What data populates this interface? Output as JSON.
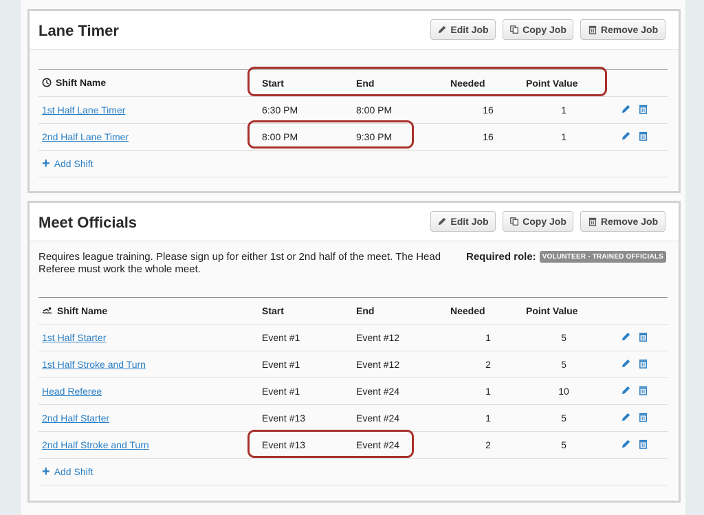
{
  "jobs": [
    {
      "title": "Lane Timer",
      "buttons": {
        "edit": "Edit Job",
        "copy": "Copy Job",
        "remove": "Remove Job"
      },
      "shift_icon": "clock-icon",
      "headers": {
        "name": "Shift Name",
        "start": "Start",
        "end": "End",
        "needed": "Needed",
        "points": "Point Value"
      },
      "shifts": [
        {
          "name": "1st Half Lane Timer",
          "start": "6:30 PM",
          "end": "8:00 PM",
          "needed": "16",
          "points": "1"
        },
        {
          "name": "2nd Half Lane Timer",
          "start": "8:00 PM",
          "end": "9:30 PM",
          "needed": "16",
          "points": "1"
        }
      ],
      "add_shift": "Add Shift"
    },
    {
      "title": "Meet Officials",
      "buttons": {
        "edit": "Edit Job",
        "copy": "Copy Job",
        "remove": "Remove Job"
      },
      "description": "Requires league training. Please sign up for either 1st or 2nd half of the meet. The Head Referee must work the whole meet.",
      "required_role_label": "Required role:",
      "required_role": "VOLUNTEER - TRAINED OFFICIALS",
      "shift_icon": "swimmer-icon",
      "headers": {
        "name": "Shift Name",
        "start": "Start",
        "end": "End",
        "needed": "Needed",
        "points": "Point Value"
      },
      "shifts": [
        {
          "name": "1st Half Starter",
          "start": "Event #1",
          "end": "Event #12",
          "needed": "1",
          "points": "5"
        },
        {
          "name": "1st Half Stroke and Turn",
          "start": "Event #1",
          "end": "Event #12",
          "needed": "2",
          "points": "5"
        },
        {
          "name": "Head Referee",
          "start": "Event #1",
          "end": "Event #24",
          "needed": "1",
          "points": "10"
        },
        {
          "name": "2nd Half Starter",
          "start": "Event #13",
          "end": "Event #24",
          "needed": "1",
          "points": "5"
        },
        {
          "name": "2nd Half Stroke and Turn",
          "start": "Event #13",
          "end": "Event #24",
          "needed": "2",
          "points": "5"
        }
      ],
      "add_shift": "Add Shift"
    }
  ],
  "colors": {
    "link": "#2b7fc4",
    "highlight": "#a8302b",
    "badge": "#8c8c8c"
  }
}
